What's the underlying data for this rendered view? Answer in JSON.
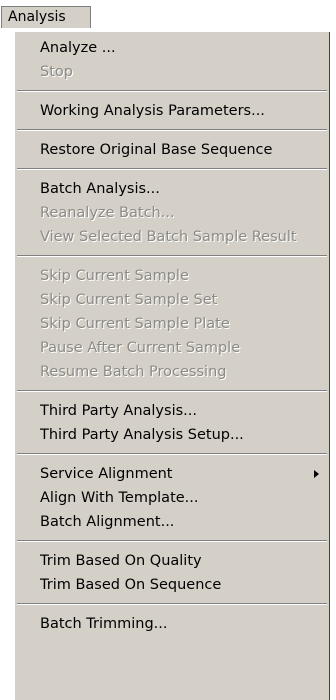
{
  "menubar": {
    "title": "Analysis"
  },
  "menu": {
    "groups": [
      [
        {
          "label": "Analyze ...",
          "enabled": true
        },
        {
          "label": "Stop",
          "enabled": false
        }
      ],
      [
        {
          "label": "Working Analysis Parameters...",
          "enabled": true
        }
      ],
      [
        {
          "label": "Restore Original Base Sequence",
          "enabled": true
        }
      ],
      [
        {
          "label": "Batch Analysis...",
          "enabled": true
        },
        {
          "label": "Reanalyze Batch...",
          "enabled": false
        },
        {
          "label": "View Selected Batch Sample Result",
          "enabled": false
        }
      ],
      [
        {
          "label": "Skip Current Sample",
          "enabled": false
        },
        {
          "label": "Skip Current Sample Set",
          "enabled": false
        },
        {
          "label": "Skip Current Sample Plate",
          "enabled": false
        },
        {
          "label": "Pause After Current Sample",
          "enabled": false
        },
        {
          "label": "Resume Batch Processing",
          "enabled": false
        }
      ],
      [
        {
          "label": "Third Party Analysis...",
          "enabled": true
        },
        {
          "label": "Third Party Analysis Setup...",
          "enabled": true
        }
      ],
      [
        {
          "label": "Service Alignment",
          "enabled": true,
          "submenu": true
        },
        {
          "label": "Align With Template...",
          "enabled": true
        },
        {
          "label": "Batch Alignment...",
          "enabled": true
        }
      ],
      [
        {
          "label": "Trim Based On Quality",
          "enabled": true
        },
        {
          "label": "Trim Based On Sequence",
          "enabled": true
        }
      ],
      [
        {
          "label": "Batch Trimming...",
          "enabled": true
        }
      ]
    ]
  }
}
